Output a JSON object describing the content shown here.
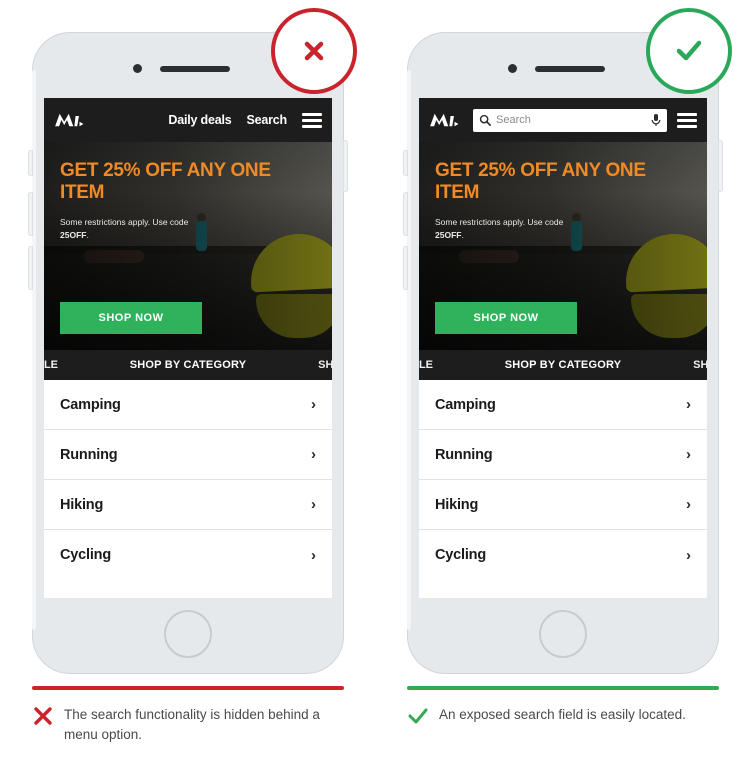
{
  "panels": [
    {
      "variant": "bad",
      "badge_icon": "x-mark-icon",
      "badge_color": "#c9242c",
      "rule_color": "#cc2229",
      "caption_icon": "x-mark-icon",
      "caption": "The search functionality is hidden behind a menu option.",
      "header": {
        "logo": "brand-logo-m",
        "has_search_field": false,
        "links": [
          "Daily deals",
          "Search"
        ],
        "menu_icon": "hamburger-menu-icon"
      },
      "hero": {
        "title": "GET 25% OFF ANY ONE ITEM",
        "sub_prefix": "Some restrictions apply. Use code ",
        "sub_code": "25OFF",
        "sub_suffix": ".",
        "cta": "SHOP NOW",
        "cta_color": "#2eb35c",
        "title_color": "#f08a24"
      },
      "tabs": {
        "left_partial": "ALE",
        "center": "SHOP BY CATEGORY",
        "right_partial": "SHO"
      },
      "categories": [
        "Camping",
        "Running",
        "Hiking",
        "Cycling"
      ]
    },
    {
      "variant": "good",
      "badge_icon": "check-mark-icon",
      "badge_color": "#2aa85a",
      "rule_color": "#34a853",
      "caption_icon": "check-mark-icon",
      "caption": "An exposed search field is easily located.",
      "header": {
        "logo": "brand-logo-m",
        "has_search_field": true,
        "search_placeholder": "Search",
        "search_value": "",
        "search_icon": "magnifier-icon",
        "voice_icon": "microphone-icon",
        "links": [],
        "menu_icon": "hamburger-menu-icon"
      },
      "hero": {
        "title": "GET 25% OFF ANY ONE ITEM",
        "sub_prefix": "Some restrictions apply. Use code ",
        "sub_code": "25OFF",
        "sub_suffix": ".",
        "cta": "SHOP NOW",
        "cta_color": "#2eb35c",
        "title_color": "#f08a24"
      },
      "tabs": {
        "left_partial": "ALE",
        "center": "SHOP BY CATEGORY",
        "right_partial": "SHO"
      },
      "categories": [
        "Camping",
        "Running",
        "Hiking",
        "Cycling"
      ]
    }
  ],
  "chevron_glyph": "›"
}
